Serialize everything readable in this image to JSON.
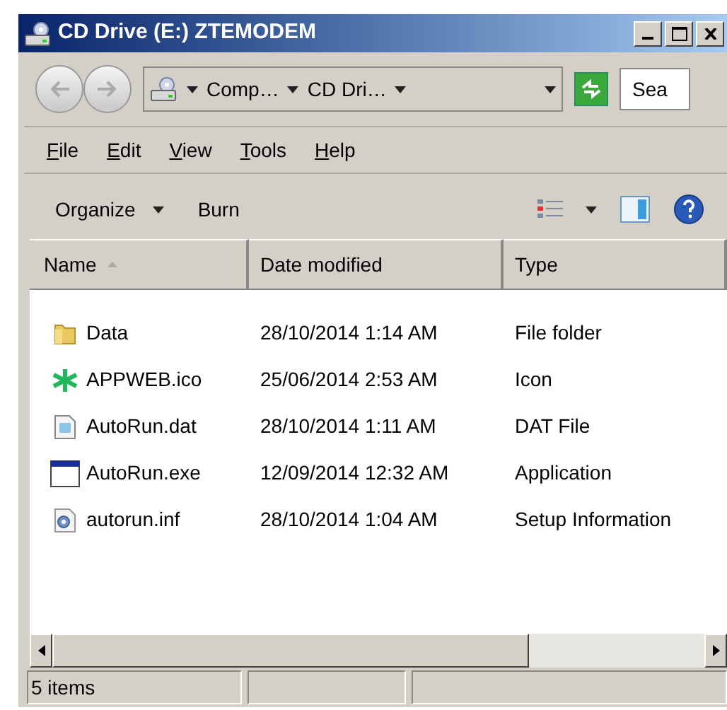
{
  "window": {
    "title": "CD Drive (E:) ZTEMODEM"
  },
  "address_bar": {
    "crumbs": [
      "Comp…",
      "CD Dri…"
    ]
  },
  "search": {
    "placeholder": "Sea"
  },
  "menu": [
    "File",
    "Edit",
    "View",
    "Tools",
    "Help"
  ],
  "commands": [
    {
      "label": "Organize",
      "dropdown": true
    },
    {
      "label": "Burn",
      "dropdown": false
    }
  ],
  "columns": [
    {
      "label": "Name",
      "sorted": true
    },
    {
      "label": "Date modified",
      "sorted": false
    },
    {
      "label": "Type",
      "sorted": false
    }
  ],
  "files": [
    {
      "kind": "folder",
      "name": "Data",
      "date": "28/10/2014 1:14 AM",
      "type": "File folder"
    },
    {
      "kind": "icon",
      "name": "APPWEB.ico",
      "date": "25/06/2014 2:53 AM",
      "type": "Icon"
    },
    {
      "kind": "dat",
      "name": "AutoRun.dat",
      "date": "28/10/2014 1:11 AM",
      "type": "DAT File"
    },
    {
      "kind": "exe",
      "name": "AutoRun.exe",
      "date": "12/09/2014 12:32 AM",
      "type": "Application"
    },
    {
      "kind": "inf",
      "name": "autorun.inf",
      "date": "28/10/2014 1:04 AM",
      "type": "Setup Information"
    }
  ],
  "status_bar": {
    "count": "5 items"
  }
}
